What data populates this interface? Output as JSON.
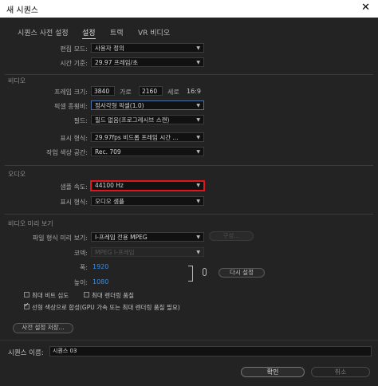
{
  "window": {
    "title": "새 시퀀스",
    "close_glyph": "✕"
  },
  "tabs": [
    {
      "label": "시퀀스 사전 설정"
    },
    {
      "label": "설정"
    },
    {
      "label": "트랙"
    },
    {
      "label": "VR 비디오"
    }
  ],
  "edit_mode": {
    "label": "편집 모드:",
    "value": "사용자 정의"
  },
  "timebase": {
    "label": "시간 기준:",
    "value": "29.97  프레임/초"
  },
  "video": {
    "section": "비디오",
    "frame_size_label": "프레임 크기:",
    "width": "3840",
    "horizontal": "가로",
    "height": "2160",
    "vertical": "세로",
    "aspect": "16:9",
    "pixel_aspect_label": "픽셀 종횡비:",
    "pixel_aspect_value": "정사각형 픽셀(1.0)",
    "fields_label": "필드:",
    "fields_value": "필드 없음(프로그레시브 스캔)",
    "display_format_label": "표시 형식:",
    "display_format_value": "29.97fps 비드롭 프레임 시간 ...",
    "color_space_label": "작업 색상 공간:",
    "color_space_value": "Rec. 709"
  },
  "audio": {
    "section": "오디오",
    "sample_rate_label": "샘플 속도:",
    "sample_rate_value": "44100 Hz",
    "display_format_label": "표시 형식:",
    "display_format_value": "오디오 샘플"
  },
  "preview": {
    "section": "비디오 미리 보기",
    "file_format_label": "파일 형식 미리 보기:",
    "file_format_value": "I-프레임 전용 MPEG",
    "configure_label": "구성...",
    "codec_label": "코덱:",
    "codec_value": "MPEG I-프레임",
    "width_label": "폭:",
    "width_value": "1920",
    "height_label": "높이:",
    "height_value": "1080",
    "reset_label": "다시 설정"
  },
  "options": {
    "max_bit_depth": "최대 비트 심도",
    "max_render_quality": "최대 렌더링 품질",
    "linear_color": "선형 색상으로 합성(GPU 가속 또는 최대 렌더링 품질 필요)"
  },
  "save_preset_label": "사전 설정 저장...",
  "sequence_name_label": "시퀀스 이름:",
  "sequence_name_value": "시퀀스 03",
  "ok_label": "확인",
  "cancel_label": "취소",
  "colors": {
    "highlight": "#e0161e",
    "blue_value": "#3c8de0"
  }
}
